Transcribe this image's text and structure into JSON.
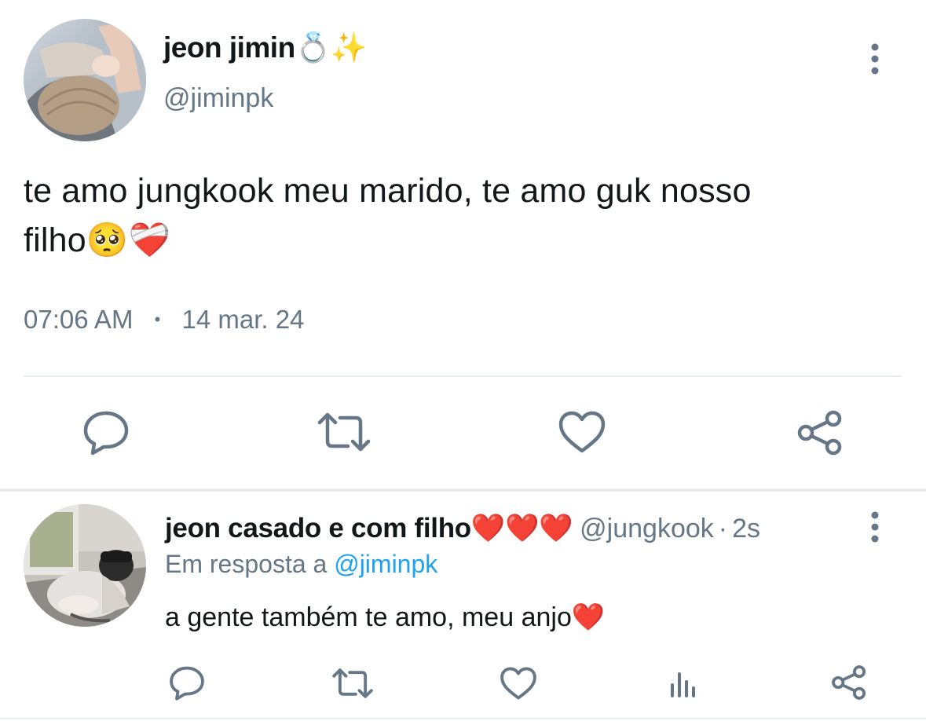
{
  "tweet": {
    "author": {
      "name": "jeon jimin",
      "name_emoji": "💍✨",
      "handle": "@jiminpk",
      "avatar_icon": "profile-photo"
    },
    "text_line1": "te amo jungkook meu marido, te amo guk nosso",
    "text_line2": "filho",
    "text_emoji": "🥺❤️‍🩹",
    "time": "07:06 AM",
    "separator": "•",
    "date": "14 mar. 24",
    "actions": [
      "reply-icon",
      "retweet-icon",
      "like-icon",
      "share-icon"
    ]
  },
  "reply": {
    "author": {
      "name": "jeon casado e com filho",
      "name_emoji": "❤️❤️❤️",
      "handle": "@jungkook",
      "time_sep": "·",
      "time": "2s",
      "avatar_icon": "profile-photo"
    },
    "reply_prefix": "Em resposta a ",
    "reply_to": "@jiminpk",
    "text": "a gente também te amo, meu anjo",
    "text_emoji": "❤️",
    "actions": [
      "reply-icon",
      "retweet-icon",
      "like-icon",
      "analytics-icon",
      "share-icon"
    ]
  },
  "colors": {
    "text": "#14171a",
    "secondary": "#657786",
    "link": "#1da1f2",
    "divider": "#e6ecf0"
  }
}
